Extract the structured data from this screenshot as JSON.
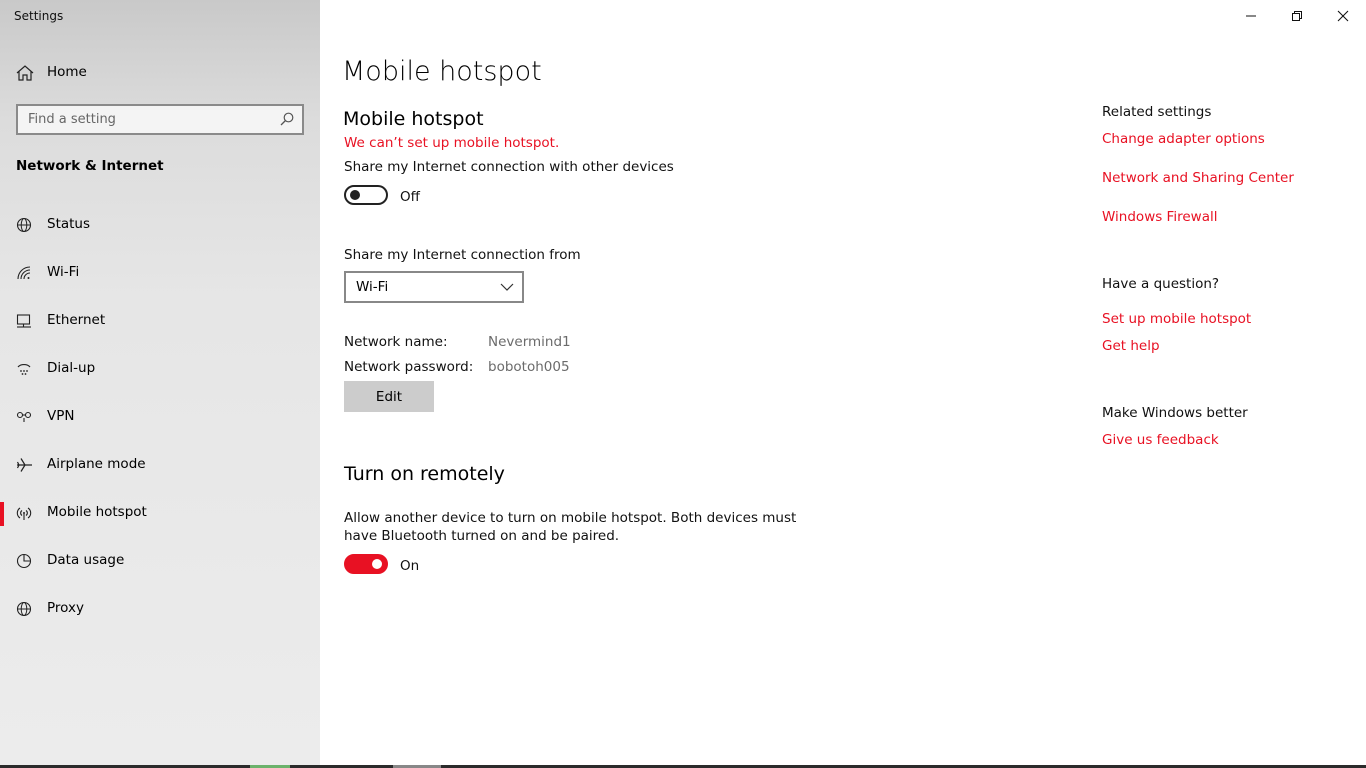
{
  "window": {
    "title": "Settings"
  },
  "sidebar": {
    "home_label": "Home",
    "search_placeholder": "Find a setting",
    "section_title": "Network & Internet",
    "items": [
      {
        "label": "Status",
        "icon": "globe-status-icon"
      },
      {
        "label": "Wi-Fi",
        "icon": "wifi-icon"
      },
      {
        "label": "Ethernet",
        "icon": "ethernet-icon"
      },
      {
        "label": "Dial-up",
        "icon": "dialup-icon"
      },
      {
        "label": "VPN",
        "icon": "vpn-icon"
      },
      {
        "label": "Airplane mode",
        "icon": "airplane-icon"
      },
      {
        "label": "Mobile hotspot",
        "icon": "hotspot-icon",
        "active": true
      },
      {
        "label": "Data usage",
        "icon": "data-usage-icon"
      },
      {
        "label": "Proxy",
        "icon": "globe-icon"
      }
    ]
  },
  "main": {
    "page_title": "Mobile hotspot",
    "section_title": "Mobile hotspot",
    "error": "We can’t set up mobile hotspot.",
    "share_label": "Share my Internet connection with other devices",
    "share_toggle": {
      "state": "Off",
      "on": false
    },
    "share_from_label": "Share my Internet connection from",
    "share_from_value": "Wi-Fi",
    "network_name_label": "Network name:",
    "network_name_value": "Nevermind1",
    "network_password_label": "Network password:",
    "network_password_value": "bobotoh005",
    "edit_label": "Edit",
    "remote_title": "Turn on remotely",
    "remote_desc_line1": "Allow another device to turn on mobile hotspot. Both devices must",
    "remote_desc_line2": "have Bluetooth turned on and be paired.",
    "remote_toggle": {
      "state": "On",
      "on": true
    }
  },
  "related": {
    "heading": "Related settings",
    "links": [
      "Change adapter options",
      "Network and Sharing Center",
      "Windows Firewall"
    ],
    "question_heading": "Have a question?",
    "question_links": [
      "Set up mobile hotspot",
      "Get help"
    ],
    "better_heading": "Make Windows better",
    "better_link": "Give us feedback"
  },
  "colors": {
    "accent": "#e81123",
    "sidebar_bg": "#e6e6e6"
  }
}
